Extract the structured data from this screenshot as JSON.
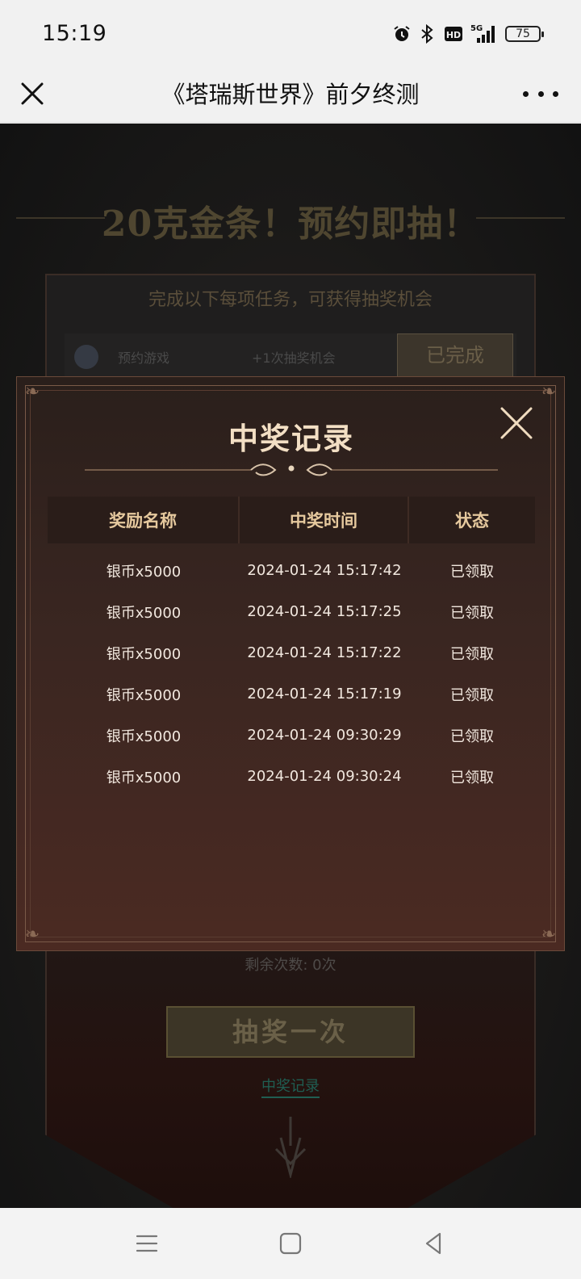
{
  "status_bar": {
    "time": "15:19",
    "icons": [
      "alarm-icon",
      "bluetooth-icon",
      "hd-icon",
      "5g-signal-icon"
    ],
    "battery": "75"
  },
  "title_bar": {
    "title": "《塔瑞斯世界》前夕终测",
    "close_icon": "close-icon",
    "more_icon": "more-icon"
  },
  "background": {
    "headline": "20克金条！预约即抽！",
    "subtitle": "完成以下每项任务，可获得抽奖机会",
    "task": {
      "name": "预约游戏",
      "reward": "+1次抽奖机会",
      "button": "已完成"
    },
    "remaining": "剩余次数: 0次",
    "draw_button": "抽奖一次",
    "record_link": "中奖记录"
  },
  "modal": {
    "title": "中奖记录",
    "columns": [
      "奖励名称",
      "中奖时间",
      "状态"
    ],
    "rows": [
      [
        "银币x5000",
        "2024-01-24 15:17:42",
        "已领取"
      ],
      [
        "银币x5000",
        "2024-01-24 15:17:25",
        "已领取"
      ],
      [
        "银币x5000",
        "2024-01-24 15:17:22",
        "已领取"
      ],
      [
        "银币x5000",
        "2024-01-24 15:17:19",
        "已领取"
      ],
      [
        "银币x5000",
        "2024-01-24 09:30:29",
        "已领取"
      ],
      [
        "银币x5000",
        "2024-01-24 09:30:24",
        "已领取"
      ]
    ]
  },
  "nav_bar": {
    "items": [
      "menu-icon",
      "home-icon",
      "back-icon"
    ]
  },
  "colors": {
    "modal_title": "#f3dfc4",
    "table_header_text": "#e6c99e",
    "table_cell_text": "#f2e8df"
  }
}
